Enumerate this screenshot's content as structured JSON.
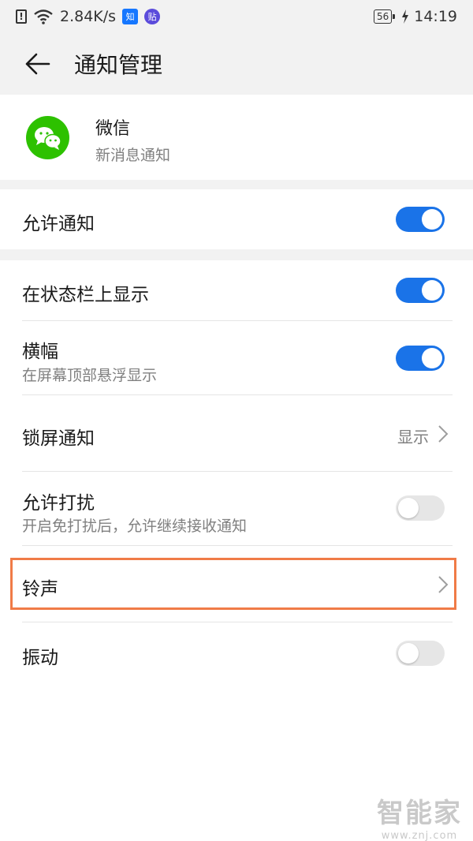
{
  "status_bar": {
    "network_speed": "2.84K/s",
    "badge_zhihu": "知",
    "badge_tieba": "贴",
    "battery": "56",
    "time": "14:19"
  },
  "header": {
    "title": "通知管理"
  },
  "app": {
    "name": "微信",
    "subtitle": "新消息通知"
  },
  "settings": {
    "allow_notifications": {
      "label": "允许通知",
      "enabled": true
    },
    "status_bar_display": {
      "label": "在状态栏上显示",
      "enabled": true
    },
    "banner": {
      "label": "横幅",
      "sub": "在屏幕顶部悬浮显示",
      "enabled": true
    },
    "lock_screen": {
      "label": "锁屏通知",
      "value": "显示"
    },
    "dnd": {
      "label": "允许打扰",
      "sub": "开启免打扰后，允许继续接收通知",
      "enabled": false
    },
    "ringtone": {
      "label": "铃声"
    },
    "vibration": {
      "label": "振动",
      "enabled": false
    }
  },
  "watermark": {
    "text": "智能家",
    "url": "www.znj.com"
  },
  "colors": {
    "accent": "#1a73e8",
    "highlight": "#f07b47",
    "wechat": "#2dc100"
  }
}
